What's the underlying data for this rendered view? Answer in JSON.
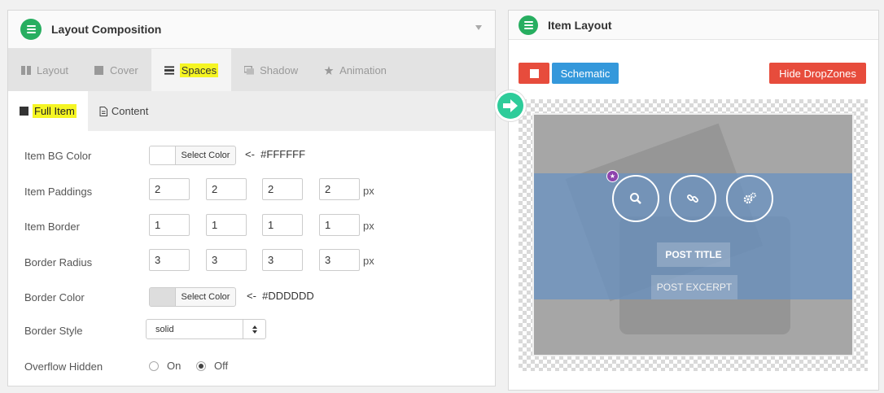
{
  "left_panel": {
    "title": "Layout Composition",
    "tabs": [
      {
        "label": "Layout",
        "icon": "columns-icon"
      },
      {
        "label": "Cover",
        "icon": "square-icon"
      },
      {
        "label": "Spaces",
        "icon": "spaces-icon",
        "active": true
      },
      {
        "label": "Shadow",
        "icon": "shadow-icon"
      },
      {
        "label": "Animation",
        "icon": "star-icon"
      }
    ],
    "subtabs": [
      {
        "label": "Full Item",
        "icon": "square-icon",
        "active": true
      },
      {
        "label": "Content",
        "icon": "document-icon"
      }
    ],
    "form": {
      "bg_color": {
        "label": "Item BG Color",
        "button": "Select Color",
        "arrow": "<-",
        "value": "#FFFFFF"
      },
      "paddings": {
        "label": "Item Paddings",
        "values": [
          "2",
          "2",
          "2",
          "2"
        ],
        "unit": "px"
      },
      "border": {
        "label": "Item Border",
        "values": [
          "1",
          "1",
          "1",
          "1"
        ],
        "unit": "px"
      },
      "radius": {
        "label": "Border Radius",
        "values": [
          "3",
          "3",
          "3",
          "3"
        ],
        "unit": "px"
      },
      "border_color": {
        "label": "Border Color",
        "button": "Select Color",
        "arrow": "<-",
        "value": "#DDDDDD"
      },
      "border_style": {
        "label": "Border Style",
        "value": "solid"
      },
      "overflow": {
        "label": "Overflow Hidden",
        "on": "On",
        "off": "Off",
        "selected": "Off"
      }
    }
  },
  "right_panel": {
    "title": "Item Layout",
    "schematic_label": "Schematic",
    "hide_dropzones_label": "Hide DropZones",
    "preview": {
      "post_title": "POST TITLE",
      "post_excerpt": "POST EXCERPT"
    }
  },
  "colors": {
    "accent_green": "#27ae60",
    "red": "#e74c3c",
    "blue": "#3498db",
    "highlight": "#f5f523",
    "overlay": "#6692c4",
    "badge_purple": "#8e44ad"
  }
}
